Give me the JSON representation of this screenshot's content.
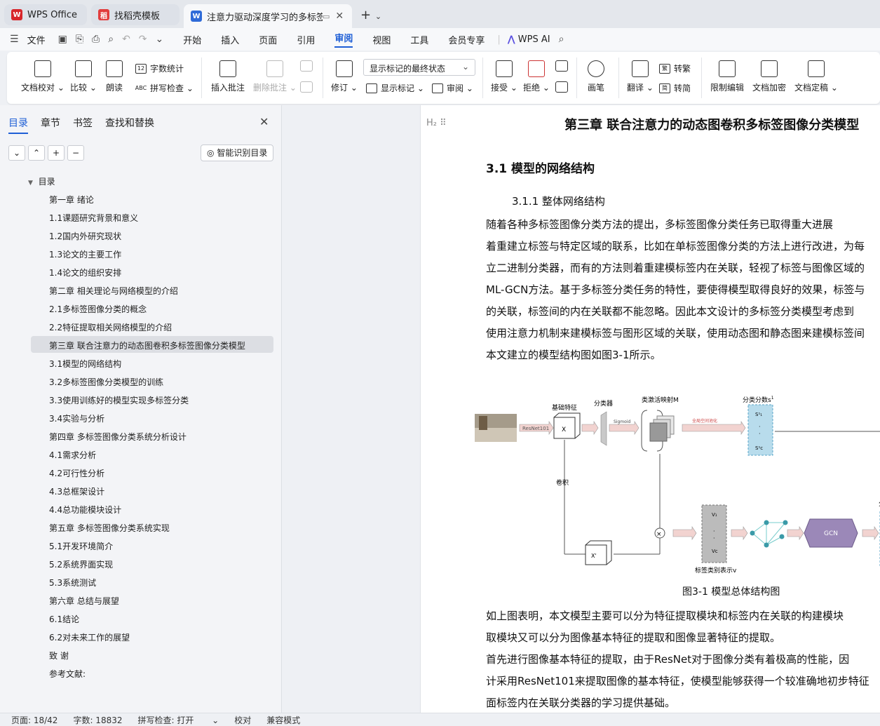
{
  "tabs": [
    {
      "label": "WPS Office",
      "icon": "wps-logo-icon",
      "color": "#d7262b"
    },
    {
      "label": "找稻壳模板",
      "icon": "docer-icon",
      "color": "#e23d3d"
    },
    {
      "label": "注意力驱动深度学习的多标签",
      "icon": "word-doc-icon",
      "color": "#2f6bd8"
    }
  ],
  "menu": {
    "file": "文件",
    "items": [
      "开始",
      "插入",
      "页面",
      "引用",
      "审阅",
      "视图",
      "工具",
      "会员专享"
    ],
    "active": "审阅",
    "wps_ai": "WPS AI"
  },
  "ribbon": {
    "doc_check": "文档校对",
    "compare": "比较",
    "read_aloud": "朗读",
    "word_count": "字数统计",
    "spell_check": "拼写检查",
    "insert_comment": "插入批注",
    "delete_comment": "删除批注",
    "track_changes": "修订",
    "markup_dropdown": "显示标记的最终状态",
    "show_markup": "显示标记",
    "review_pane": "审阅",
    "accept": "接受",
    "reject": "拒绝",
    "pen": "画笔",
    "translate": "翻译",
    "to_traditional": "转繁",
    "to_simplified": "转简",
    "restrict_edit": "限制编辑",
    "encrypt": "文档加密",
    "finalize": "文档定稿"
  },
  "nav_pane": {
    "tabs": [
      "目录",
      "章节",
      "书签",
      "查找和替换"
    ],
    "active_tab": "目录",
    "smart_toc": "智能识别目录",
    "root": "目录",
    "items": [
      "第一章 绪论",
      "1.1课题研究背景和意义",
      "1.2国内外研究现状",
      "1.3论文的主要工作",
      "1.4论文的组织安排",
      "第二章 相关理论与网络模型的介绍",
      "2.1多标签图像分类的概念",
      "2.2特征提取相关网络模型的介绍",
      "第三章 联合注意力的动态图卷积多标签图像分类模型",
      "3.1模型的网络结构",
      "3.2多标签图像分类模型的训练",
      "3.3使用训练好的模型实现多标签分类",
      "3.4实验与分析",
      "第四章 多标签图像分类系统分析设计",
      "4.1需求分析",
      "4.2可行性分析",
      "4.3总框架设计",
      "4.4总功能模块设计",
      "第五章 多标签图像分类系统实现",
      "5.1开发环境简介",
      "5.2系统界面实现",
      "5.3系统测试",
      "第六章 总结与展望",
      "6.1结论",
      "6.2对未来工作的展望",
      "致 谢",
      "参考文献:"
    ],
    "selected_index": 8
  },
  "document": {
    "heading_marker": "H₂",
    "chapter_title": "第三章 联合注意力的动态图卷积多标签图像分类模型",
    "section_title": "3.1  模型的网络结构",
    "subsection_title": "3.1.1      整体网络结构",
    "paragraph1": [
      "    随着各种多标签图像分类方法的提出，多标签图像分类任务已取得重大进展",
      "着重建立标签与特定区域的联系，比如在单标签图像分类的方法上进行改进，为每",
      "立二进制分类器，而有的方法则着重建模标签内在关联，轻视了标签与图像区域的",
      "ML-GCN方法。基于多标签分类任务的特性，要使得模型取得良好的效果，标签与",
      "的关联，标签间的内在关联都不能忽略。因此本文设计的多标签分类模型考虑到",
      "使用注意力机制来建模标签与图形区域的关联，使用动态图和静态图来建模标签间",
      "本文建立的模型结构图如图3-1所示。"
    ],
    "figure": {
      "basic_feature": "基础特征",
      "classifier": "分类器",
      "cam": "类激活映射M",
      "class_score": "分类分数s",
      "score_sup": "1",
      "resnet": "ResNet101",
      "sigmoid": "Sigmoid",
      "gap": "全局空间池化",
      "x": "X",
      "x_prime": "X'",
      "conv": "卷积",
      "label_repr": "标签类别表示v",
      "gcn": "GCN",
      "s1_top": "S¹₁",
      "s1_bottom": "S¹c",
      "v1": "V₁",
      "vc": "Vc",
      "cls_partial": "分"
    },
    "figure_caption": "图3-1 模型总体结构图",
    "paragraph2": [
      "    如上图表明，本文模型主要可以分为特征提取模块和标签内在关联的构建模块",
      "取模块又可以分为图像基本特征的提取和图像显著特征的提取。",
      "    首先进行图像基本特征的提取，由于ResNet对于图像分类有着极高的性能，因",
      "计采用ResNet101来提取图像的基本特征，使模型能够获得一个较准确地初步特征",
      "面标签内在关联分类器的学习提供基础。"
    ]
  },
  "status": {
    "page": "页面: 18/42",
    "words": "字数: 18832",
    "spell": "拼写检查: 打开",
    "proof": "校对",
    "compat": "兼容模式"
  }
}
